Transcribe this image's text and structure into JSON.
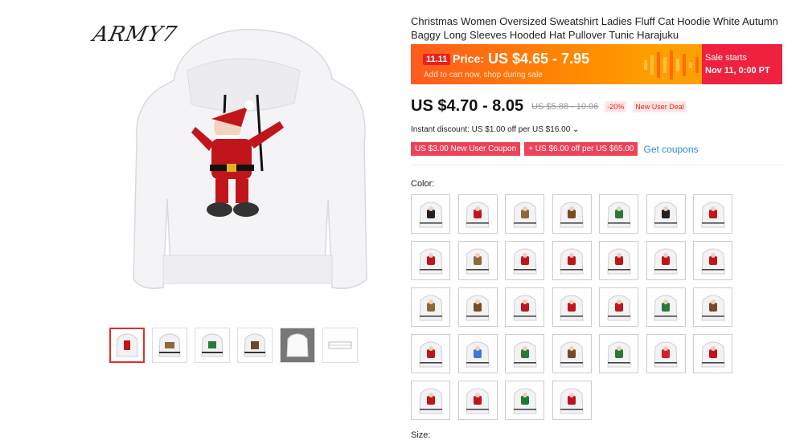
{
  "product": {
    "brand_mark": "ARMY7",
    "title": "Christmas Women Oversized Sweatshirt Ladies Fluff Cat Hoodie White Autumn Baggy Long Sleeves Hooded Hat Pullover Tunic Harajuku"
  },
  "promo": {
    "badge": "11.11",
    "price_label": "Price:",
    "price": "US $4.65 - 7.95",
    "subtext": "Add to cart now, shop during sale",
    "sale_line1": "Sale starts",
    "sale_line2": "Nov 11, 0:00 PT",
    "colors": {
      "gradient_start": "#ff5a1e",
      "gradient_end": "#ff9f00",
      "sale_bg": "#f0213f"
    }
  },
  "pricing": {
    "current": "US $4.70 - 8.05",
    "original": "US $5.88 - 10.06",
    "discount": "-20%",
    "deal_tag": "New User Deal"
  },
  "instant_discount": "Instant discount: US $1.00 off per US $16.00 ⌄",
  "coupons": [
    {
      "label": "US $3.00 New User Coupon"
    },
    {
      "label": "+ US $6.00 off per US $65.00"
    }
  ],
  "get_coupons": "Get coupons",
  "color_label": "Color:",
  "swatches": [
    {
      "figure": "panda"
    },
    {
      "figure": "santa-ride"
    },
    {
      "figure": "cat"
    },
    {
      "figure": "reindeer"
    },
    {
      "figure": "elf"
    },
    {
      "figure": "panda"
    },
    {
      "figure": "panda-santa"
    },
    {
      "figure": "santa"
    },
    {
      "figure": "cat"
    },
    {
      "figure": "santa-run"
    },
    {
      "figure": "santa"
    },
    {
      "figure": "santa"
    },
    {
      "figure": "santa"
    },
    {
      "figure": "santa"
    },
    {
      "figure": "cat"
    },
    {
      "figure": "reindeer"
    },
    {
      "figure": "santa"
    },
    {
      "figure": "santa"
    },
    {
      "figure": "santa"
    },
    {
      "figure": "elf"
    },
    {
      "figure": "reindeer"
    },
    {
      "figure": "santa"
    },
    {
      "figure": "snowman"
    },
    {
      "figure": "elf"
    },
    {
      "figure": "reindeer"
    },
    {
      "figure": "elf"
    },
    {
      "figure": "text"
    },
    {
      "figure": "santa"
    },
    {
      "figure": "santa"
    },
    {
      "figure": "santa"
    },
    {
      "figure": "number"
    },
    {
      "figure": "santa"
    }
  ],
  "size_label": "Size:",
  "thumbnails": [
    {
      "state": "active"
    },
    {
      "state": "normal"
    },
    {
      "state": "normal"
    },
    {
      "state": "normal"
    },
    {
      "state": "dark"
    },
    {
      "state": "normal"
    }
  ]
}
